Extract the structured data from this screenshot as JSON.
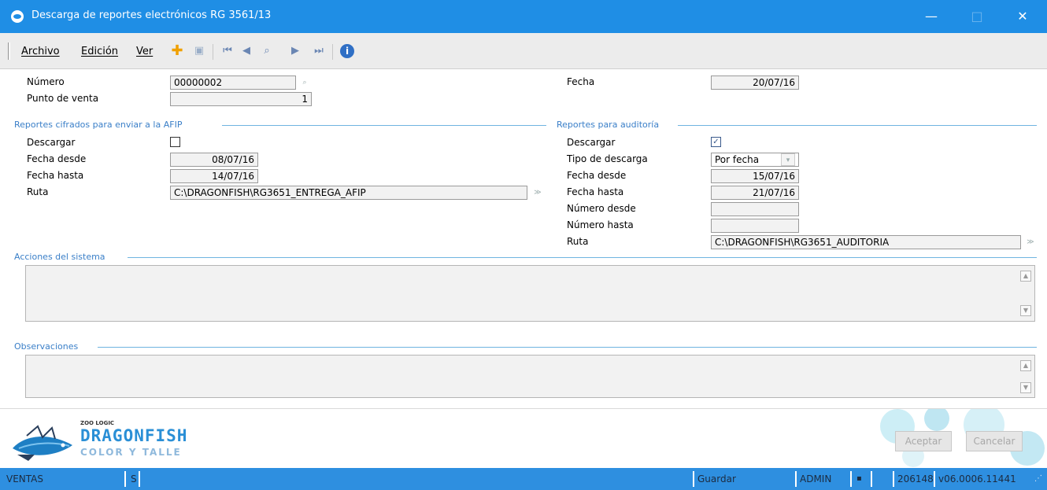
{
  "window": {
    "title": "Descarga de reportes electrónicos RG 3561/13",
    "minimize": "—",
    "maximize": "□",
    "close": "✕"
  },
  "menu": [
    "Archivo",
    "Edición",
    "Ver"
  ],
  "toolbar_icons": [
    "add-icon",
    "save-icon",
    "first-record-icon",
    "previous-record-icon",
    "search-icon",
    "next-record-icon",
    "last-record-icon",
    "info-icon"
  ],
  "header": {
    "numero_label": "Número",
    "numero_value": "00000002",
    "punto_label": "Punto de venta",
    "punto_value": "1",
    "fecha_label": "Fecha",
    "fecha_value": "20/07/16"
  },
  "afip": {
    "title": "Reportes cifrados para enviar a la AFIP",
    "descargar_label": "Descargar",
    "descargar_checked": false,
    "desde_label": "Fecha desde",
    "desde_value": "08/07/16",
    "hasta_label": "Fecha hasta",
    "hasta_value": "14/07/16",
    "ruta_label": "Ruta",
    "ruta_value": "C:\\DRAGONFISH\\RG3651_ENTREGA_AFIP"
  },
  "auditoria": {
    "title": "Reportes para auditoría",
    "descargar_label": "Descargar",
    "descargar_checked": true,
    "tipo_label": "Tipo de descarga",
    "tipo_value": "Por fecha",
    "desde_label": "Fecha desde",
    "desde_value": "15/07/16",
    "hasta_label": "Fecha hasta",
    "hasta_value": "21/07/16",
    "num_desde_label": "Número desde",
    "num_desde_value": "",
    "num_hasta_label": "Número hasta",
    "num_hasta_value": "",
    "ruta_label": "Ruta",
    "ruta_value": "C:\\DRAGONFISH\\RG3651_AUDITORIA"
  },
  "acciones": {
    "title": "Acciones del sistema",
    "value": ""
  },
  "observaciones": {
    "title": "Observaciones",
    "value": ""
  },
  "logo": {
    "zoo": "ZOO LOGIC",
    "brand": "DRAGONFISH",
    "sub": "COLOR Y TALLE"
  },
  "buttons": {
    "aceptar": "Aceptar",
    "cancelar": "Cancelar"
  },
  "status": {
    "module": "VENTAS",
    "mode": "S",
    "action": "Guardar",
    "user": "ADMIN",
    "build": "206148",
    "version": "v06.0006.11441"
  },
  "colors": {
    "titlebar": "#1f8ee5",
    "statusbar": "#2e8fe0",
    "section": "#3a7fc8"
  }
}
